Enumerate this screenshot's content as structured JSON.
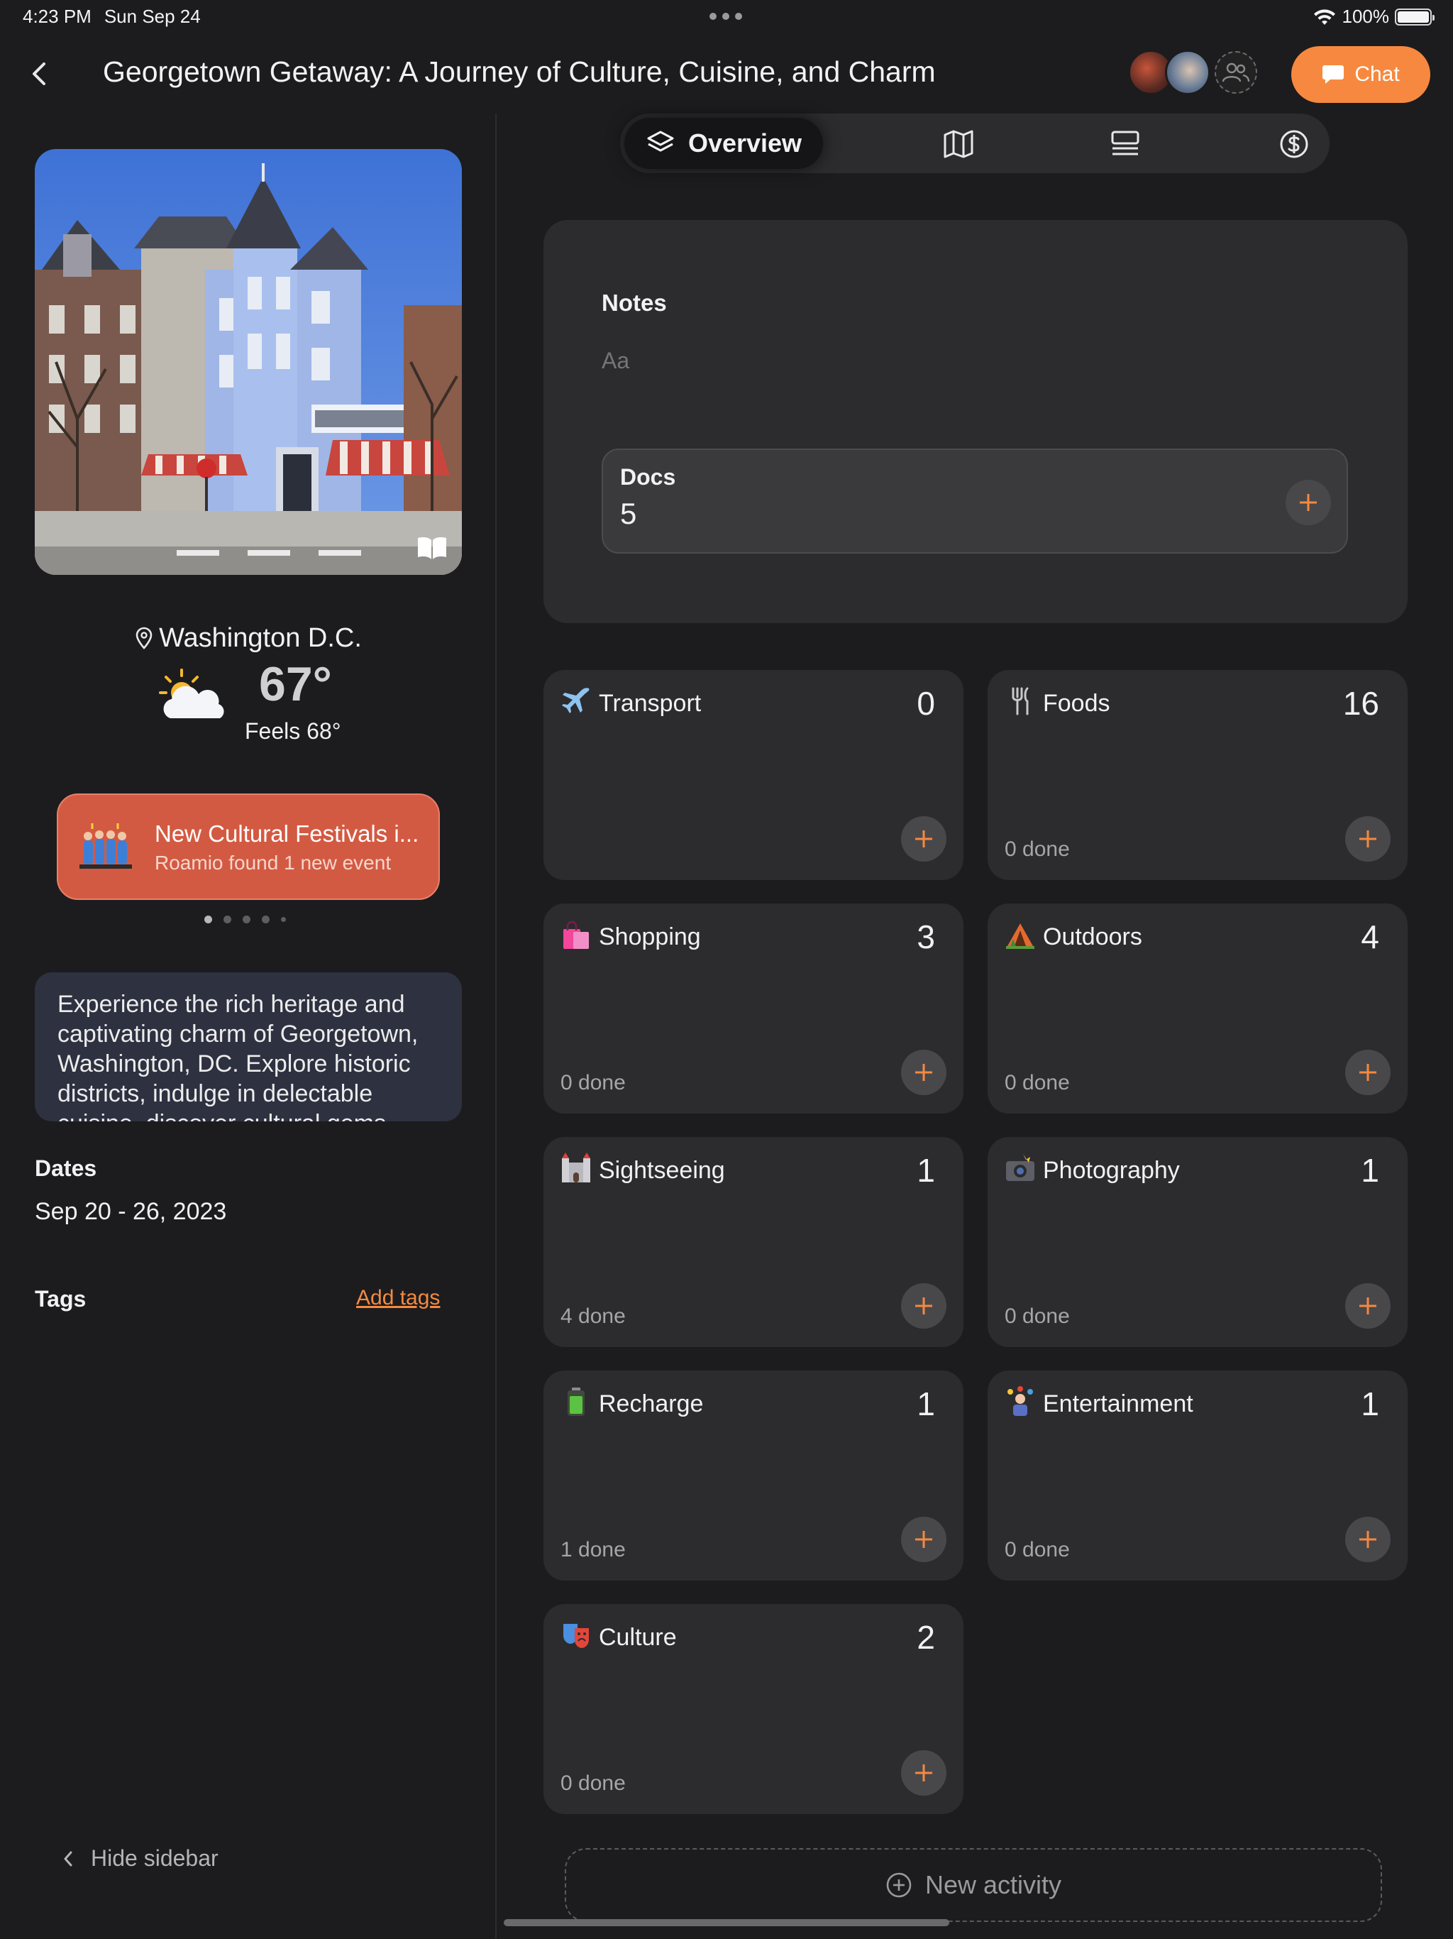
{
  "status": {
    "time": "4:23 PM",
    "date": "Sun Sep 24",
    "battery": "100%"
  },
  "header": {
    "title": "Georgetown Getaway: A Journey of Culture, Cuisine, and Charm",
    "chat_label": "Chat"
  },
  "sidebar": {
    "location": "Washington D.C.",
    "temperature": "67°",
    "feels_like": "Feels 68°",
    "event": {
      "title": "New Cultural Festivals i...",
      "subtitle": "Roamio found 1 new event"
    },
    "description": "Experience the rich heritage and captivating charm of Georgetown, Washington, DC. Explore historic districts, indulge in delectable cuisine, discover cultural gems,",
    "dates_label": "Dates",
    "dates_value": "Sep 20 - 26, 2023",
    "tags_label": "Tags",
    "add_tags": "Add tags",
    "hide_sidebar": "Hide sidebar"
  },
  "tabs": {
    "active_label": "Overview",
    "items": [
      "layers-icon",
      "map-icon",
      "list-icon",
      "dollar-icon"
    ]
  },
  "notes": {
    "label": "Notes",
    "placeholder": "Aa",
    "docs_label": "Docs",
    "docs_count": "5"
  },
  "categories": [
    {
      "name": "Transport",
      "count": "0",
      "done": "",
      "icon": "airplane-icon"
    },
    {
      "name": "Foods",
      "count": "16",
      "done": "0 done",
      "icon": "fork-knife-icon"
    },
    {
      "name": "Shopping",
      "count": "3",
      "done": "0 done",
      "icon": "shopping-bags-icon"
    },
    {
      "name": "Outdoors",
      "count": "4",
      "done": "0 done",
      "icon": "tent-icon"
    },
    {
      "name": "Sightseeing",
      "count": "1",
      "done": "4 done",
      "icon": "castle-icon"
    },
    {
      "name": "Photography",
      "count": "1",
      "done": "0 done",
      "icon": "camera-flash-icon"
    },
    {
      "name": "Recharge",
      "count": "1",
      "done": "1 done",
      "icon": "battery-icon"
    },
    {
      "name": "Entertainment",
      "count": "1",
      "done": "0 done",
      "icon": "juggler-icon"
    },
    {
      "name": "Culture",
      "count": "2",
      "done": "0 done",
      "icon": "theater-masks-icon"
    }
  ],
  "new_activity": "New activity",
  "colors": {
    "accent": "#f6893f",
    "event_card": "#d35a42",
    "background": "#1c1c1e",
    "card": "#2c2c2e"
  }
}
